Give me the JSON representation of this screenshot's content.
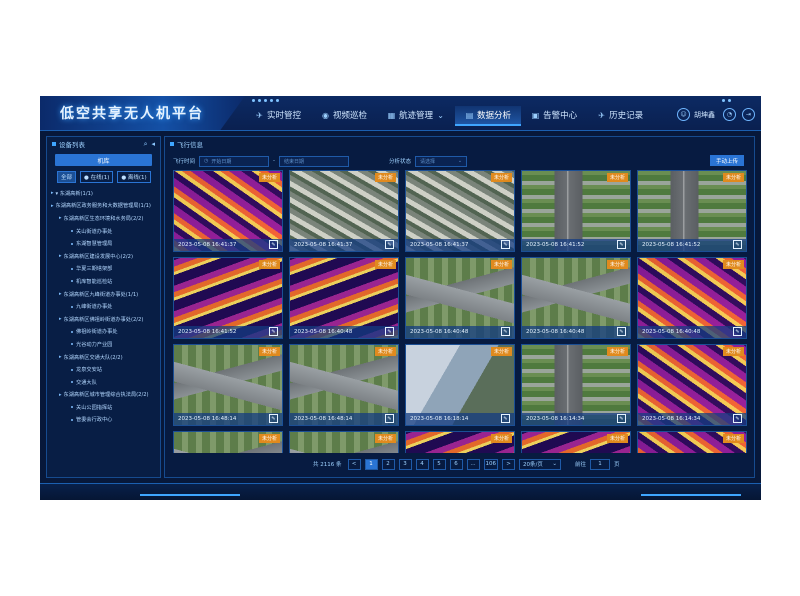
{
  "header": {
    "title": "低空共享无人机平台",
    "nav": [
      {
        "label": "实时管控",
        "icon": "drone-icon"
      },
      {
        "label": "视频巡检",
        "icon": "location-icon"
      },
      {
        "label": "航迹管理",
        "icon": "calendar-icon",
        "has_dropdown": true
      },
      {
        "label": "数据分析",
        "icon": "chart-icon",
        "active": true
      },
      {
        "label": "告警中心",
        "icon": "alarm-icon"
      },
      {
        "label": "历史记录",
        "icon": "plane-icon"
      }
    ],
    "user_name": "胡坤鑫"
  },
  "sidebar": {
    "title": "设备列表",
    "machine_button": "机库",
    "filter_tabs": [
      {
        "label": "全部",
        "selected": true
      },
      {
        "label": "● 在线(1)"
      },
      {
        "label": "● 离线(1)"
      }
    ],
    "tree": [
      {
        "level": 1,
        "label": "▾ 东湖高新(1/1)",
        "caret": true
      },
      {
        "level": 1,
        "label": "东湖高新区政务服务和大数据管理局(1/1)",
        "caret": true
      },
      {
        "level": 2,
        "label": "东湖高新区生态环境和水务局(2/2)",
        "caret": true
      },
      {
        "level": 3,
        "label": "关山街道办事处"
      },
      {
        "level": 3,
        "label": "东湖智慧管理局"
      },
      {
        "level": 2,
        "label": "东湖高新区建设发展中心(2/2)",
        "caret": true
      },
      {
        "level": 3,
        "label": "华夏三期塔架部"
      },
      {
        "level": 3,
        "label": "机库智能巡检站"
      },
      {
        "level": 2,
        "label": "东湖高新区九峰街道办事处(1/1)",
        "caret": true
      },
      {
        "level": 3,
        "label": "九峰街道办事处"
      },
      {
        "level": 2,
        "label": "东湖高新区佛祖岭街道办事处(2/2)",
        "caret": true
      },
      {
        "level": 3,
        "label": "佛祖岭街道办事处"
      },
      {
        "level": 3,
        "label": "光谷动力产业园"
      },
      {
        "level": 2,
        "label": "东湖高新区交通大队(2/2)",
        "caret": true
      },
      {
        "level": 3,
        "label": "龙泉交安站"
      },
      {
        "level": 3,
        "label": "交通大队"
      },
      {
        "level": 2,
        "label": "东湖高新区城市管理综合执法局(2/2)",
        "caret": true
      },
      {
        "level": 3,
        "label": "关山公园指挥站"
      },
      {
        "level": 3,
        "label": "管委会行政中心"
      }
    ]
  },
  "main": {
    "title": "飞行信息",
    "filters": {
      "time_label": "飞行时间",
      "start_placeholder": "开始日期",
      "separator": "-",
      "end_placeholder": "结束日期",
      "status_label": "分析状态",
      "status_placeholder": "请选择",
      "upload_button": "手动上传"
    },
    "badge_text": "未分析",
    "cards": [
      {
        "time": "2023-05-08 16:41:37",
        "kind": "thermal"
      },
      {
        "time": "2023-05-08 16:41:37",
        "kind": "city"
      },
      {
        "time": "2023-05-08 16:41:37",
        "kind": "city"
      },
      {
        "time": "2023-05-08 16:41:52",
        "kind": "road"
      },
      {
        "time": "2023-05-08 16:41:52",
        "kind": "road"
      },
      {
        "time": "2023-05-08 16:41:52",
        "kind": "thermal2"
      },
      {
        "time": "2023-05-08 16:40:48",
        "kind": "thermal2"
      },
      {
        "time": "2023-05-08 16:40:48",
        "kind": "overpass"
      },
      {
        "time": "2023-05-08 16:40:48",
        "kind": "overpass"
      },
      {
        "time": "2023-05-08 16:40:48",
        "kind": "thermal"
      },
      {
        "time": "2023-05-08 16:48:14",
        "kind": "overpass"
      },
      {
        "time": "2023-05-08 16:48:14",
        "kind": "overpass"
      },
      {
        "time": "2023-05-08 16:18:14",
        "kind": "tower"
      },
      {
        "time": "2023-05-08 16:14:34",
        "kind": "road"
      },
      {
        "time": "2023-05-08 16:14:34",
        "kind": "thermal"
      },
      {
        "time": "",
        "kind": "overpass"
      },
      {
        "time": "",
        "kind": "overpass"
      },
      {
        "time": "",
        "kind": "thermal2"
      },
      {
        "time": "",
        "kind": "thermal2"
      },
      {
        "time": "",
        "kind": "thermal"
      }
    ],
    "pagination": {
      "total_text": "共 2116 条",
      "prev": "<",
      "pages": [
        "1",
        "2",
        "3",
        "4",
        "5",
        "6",
        "...",
        "106"
      ],
      "current": "1",
      "next": ">",
      "page_size": "20条/页",
      "goto_label": "前往",
      "goto_value": "1",
      "goto_suffix": "页"
    }
  },
  "colors": {
    "background": "#07183a",
    "accent": "#2a74d4",
    "badge": "#e08a1e"
  }
}
